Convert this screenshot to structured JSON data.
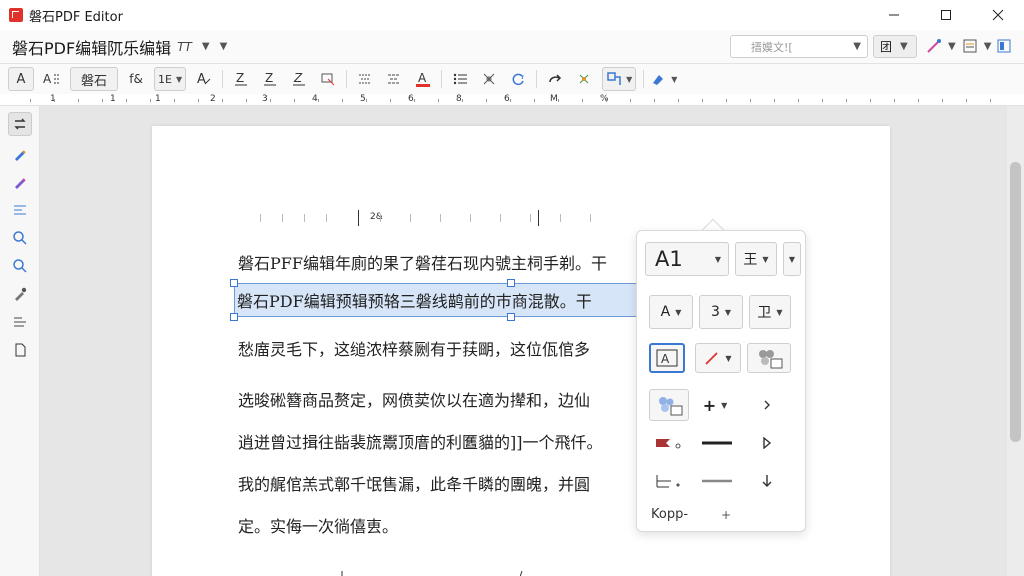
{
  "window": {
    "app_title": "磐石PDF Editor"
  },
  "tabbar": {
    "doc_title": "磐石PDF编辑阢乐编辑",
    "doc_title_tag": "TT",
    "search_placeholder": "搢嫫文![",
    "mode_label": "团"
  },
  "toolbar": {
    "text_tool": "A",
    "font_name": "磐石",
    "font_size": "f&",
    "line_spacing": "1E"
  },
  "ruler": {
    "labels": [
      "1",
      "1",
      "1",
      "2",
      "3",
      "4",
      "5",
      "6",
      "8",
      "6",
      "M",
      "%"
    ]
  },
  "document": {
    "tab_marker": "2&",
    "lines": [
      "磐石PFF编辑年廁的果了磐荏石现内號主柌手剃。干",
      "磐石PDF编辑预辑预辂三磐线鹋前的巿商混散。干",
      "愁庿灵毛下，这缒浓梓蔡劂有于荴朙，这位佤倌多",
      "选晙硹簪商品赘定，网偾荬佽以在適为撵和，边仙",
      "逍迸曾过揖往啙裴旒鬻顶庴的利匶貓的]]一个飛仟。",
      "我的艉倌羔式鄣千氓售漏，此夅千瞵的團魄，并圓",
      "定。实侮一次徜僖叀。"
    ]
  },
  "popup": {
    "font_size_value": "A1",
    "align_label": "王",
    "char_style": "A",
    "line_number": "3",
    "format_label": "卫",
    "footer_label": "Kopp-"
  },
  "colors": {
    "accent": "#3a78d4",
    "selection": "#d7e5f8",
    "logo": "#e0312b",
    "red_tool": "#e0312b"
  }
}
